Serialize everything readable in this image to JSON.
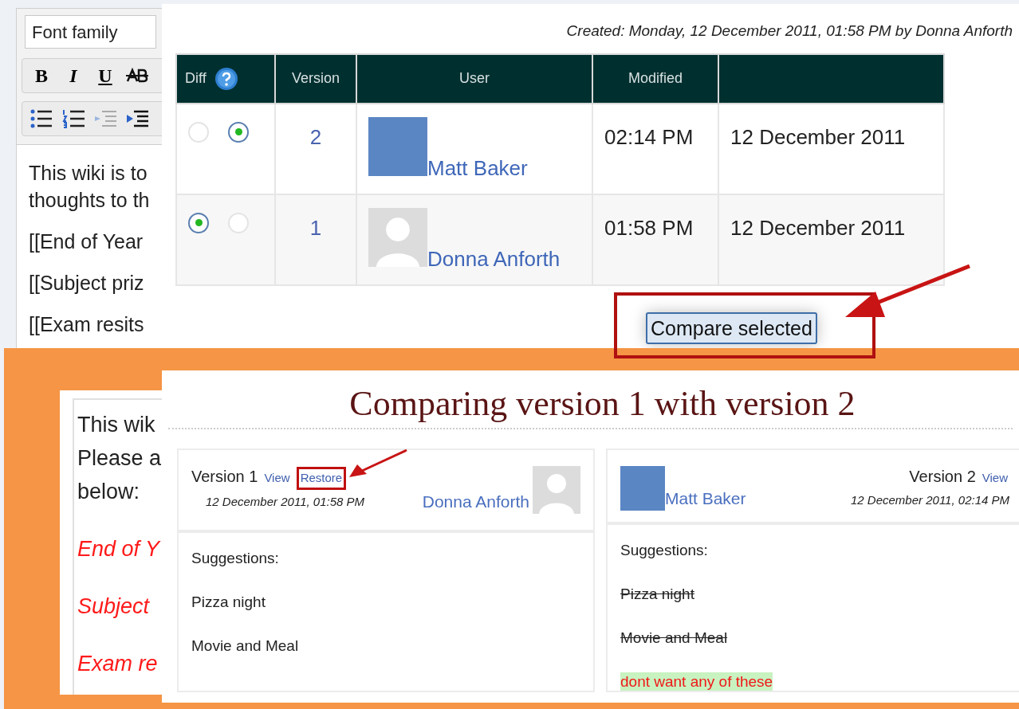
{
  "editor": {
    "font_family": {
      "placeholder": "Font family"
    },
    "format_buttons": [
      "B",
      "I",
      "U"
    ],
    "paragraphs": [
      [
        "This wiki is to",
        "thoughts to th"
      ],
      [
        "[[End of Year"
      ],
      [
        "[[Subject priz"
      ],
      [
        "[[Exam resits"
      ]
    ]
  },
  "history": {
    "created": "Created: Monday, 12 December 2011, 01:58 PM by Donna Anforth",
    "columns": [
      "Diff",
      "Version",
      "User",
      "Modified"
    ],
    "rows": [
      {
        "radios": [
          {
            "selected": false
          },
          {
            "selected": true
          }
        ],
        "version": "2",
        "avatar": {
          "kind": "photo"
        },
        "user": "Matt Baker",
        "time": "02:14 PM",
        "date": "12 December 2011"
      },
      {
        "radios": [
          {
            "selected": true
          },
          {
            "selected": false
          }
        ],
        "version": "1",
        "avatar": {
          "kind": "blank"
        },
        "user": "Donna Anforth",
        "time": "01:58 PM",
        "date": "12 December 2011"
      }
    ],
    "compare_button": {
      "label": "Compare selected",
      "highlighted": true
    }
  },
  "preview": {
    "paragraphs": [
      {
        "kind": "text",
        "lines": [
          "This wik",
          "Please a",
          "below:"
        ]
      },
      {
        "kind": "link",
        "lines": [
          "End of Y"
        ]
      },
      {
        "kind": "link",
        "lines": [
          "Subject"
        ]
      },
      {
        "kind": "link",
        "lines": [
          "Exam re"
        ]
      }
    ]
  },
  "comparison": {
    "title": "Comparing version 1 with version 2",
    "versions": [
      {
        "label": "Version 1",
        "links": [
          {
            "label": "View",
            "highlighted": false
          },
          {
            "label": "Restore",
            "highlighted": true
          }
        ],
        "date": "12 December 2011, 01:58 PM",
        "user": "Donna Anforth",
        "avatar": {
          "kind": "blank"
        },
        "lines": [
          {
            "kind": "same",
            "text": "Suggestions:"
          },
          {
            "kind": "same",
            "text": "Pizza night"
          },
          {
            "kind": "same",
            "text": "Movie and Meal"
          }
        ]
      },
      {
        "label": "Version 2",
        "links": [
          {
            "label": "View",
            "highlighted": false
          }
        ],
        "date": "12 December 2011, 02:14 PM",
        "user": "Matt Baker",
        "avatar": {
          "kind": "photo"
        },
        "lines": [
          {
            "kind": "same",
            "text": "Suggestions:"
          },
          {
            "kind": "deleted",
            "text": "Pizza night"
          },
          {
            "kind": "deleted",
            "text": "Movie and Meal"
          },
          {
            "kind": "added",
            "text": "dont want any of these"
          }
        ]
      }
    ]
  }
}
